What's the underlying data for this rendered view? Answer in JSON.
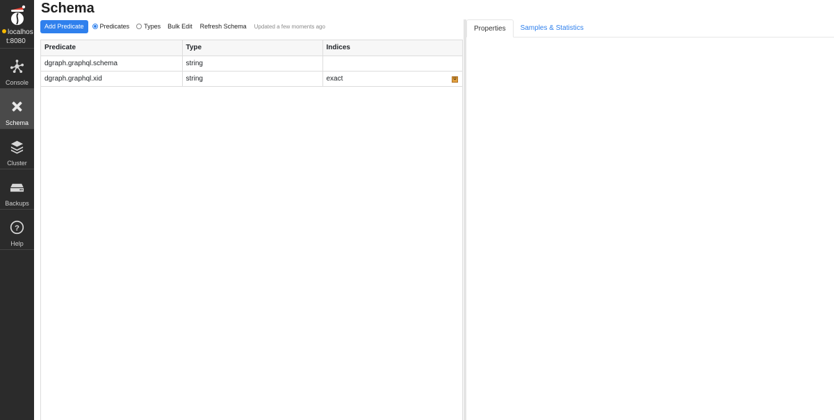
{
  "sidebar": {
    "server": {
      "line1": "localhos",
      "line2": "t:8080",
      "status_color": "#f5b800"
    },
    "items": [
      {
        "label": "Console",
        "icon": "console-icon",
        "active": false
      },
      {
        "label": "Schema",
        "icon": "schema-icon",
        "active": true
      },
      {
        "label": "Cluster",
        "icon": "cluster-icon",
        "active": false
      },
      {
        "label": "Backups",
        "icon": "backups-icon",
        "active": false
      },
      {
        "label": "Help",
        "icon": "help-icon",
        "active": false
      }
    ]
  },
  "page": {
    "title": "Schema"
  },
  "toolbar": {
    "add_predicate": "Add Predicate",
    "radio_predicates": "Predicates",
    "radio_types": "Types",
    "bulk_edit": "Bulk Edit",
    "refresh": "Refresh Schema",
    "updated": "Updated a few moments ago"
  },
  "table": {
    "headers": [
      "Predicate",
      "Type",
      "Indices"
    ],
    "rows": [
      {
        "predicate": "dgraph.graphql.schema",
        "type": "string",
        "indices": "",
        "badge": ""
      },
      {
        "predicate": "dgraph.graphql.xid",
        "type": "string",
        "indices": "exact",
        "badge": "U"
      }
    ]
  },
  "right_panel": {
    "tabs": [
      {
        "label": "Properties"
      },
      {
        "label": "Samples & Statistics"
      }
    ]
  },
  "colors": {
    "accent": "#2f80ed",
    "sidebar_bg": "#2b2b2b",
    "badge": "#e0a040"
  }
}
